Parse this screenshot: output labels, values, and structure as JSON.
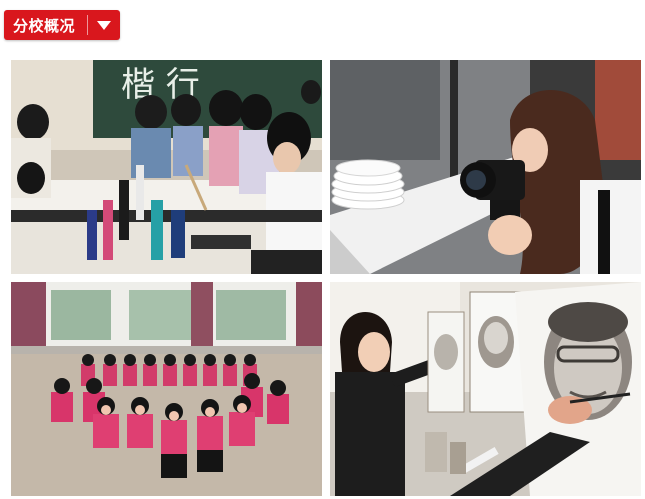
{
  "header": {
    "tag_label": "分校概况",
    "tag_color": "#d9171d",
    "dropdown_icon": "chevron-down-icon"
  },
  "gallery": {
    "photos": [
      {
        "subject": "calligraphy-class"
      },
      {
        "subject": "photography-student"
      },
      {
        "subject": "dance-class"
      },
      {
        "subject": "sketch-drawing-class"
      }
    ],
    "chalkboard_text": "楷 行"
  }
}
